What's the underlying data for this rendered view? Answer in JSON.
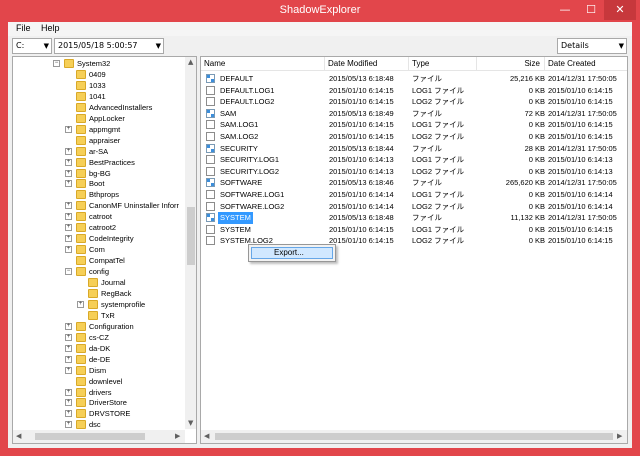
{
  "window": {
    "title": "ShadowExplorer",
    "min": "—",
    "max": "☐",
    "close": "✕"
  },
  "menu": {
    "file": "File",
    "help": "Help"
  },
  "toolbar": {
    "drive": "C:",
    "snapshot_date": "2015/05/18 5:00:57",
    "view": "Details",
    "arrow": "▼"
  },
  "tree": {
    "nodes": [
      {
        "label": "System32",
        "level": 0,
        "exp": "−"
      },
      {
        "label": "0409",
        "level": 1,
        "exp": ""
      },
      {
        "label": "1033",
        "level": 1,
        "exp": ""
      },
      {
        "label": "1041",
        "level": 1,
        "exp": ""
      },
      {
        "label": "AdvancedInstallers",
        "level": 1,
        "exp": ""
      },
      {
        "label": "AppLocker",
        "level": 1,
        "exp": ""
      },
      {
        "label": "appmgmt",
        "level": 1,
        "exp": "+"
      },
      {
        "label": "appraiser",
        "level": 1,
        "exp": ""
      },
      {
        "label": "ar-SA",
        "level": 1,
        "exp": "+"
      },
      {
        "label": "BestPractices",
        "level": 1,
        "exp": "+"
      },
      {
        "label": "bg-BG",
        "level": 1,
        "exp": "+"
      },
      {
        "label": "Boot",
        "level": 1,
        "exp": "+"
      },
      {
        "label": "Bthprops",
        "level": 1,
        "exp": ""
      },
      {
        "label": "CanonMF Uninstaller Inforr",
        "level": 1,
        "exp": "+"
      },
      {
        "label": "catroot",
        "level": 1,
        "exp": "+"
      },
      {
        "label": "catroot2",
        "level": 1,
        "exp": "+"
      },
      {
        "label": "CodeIntegrity",
        "level": 1,
        "exp": "+"
      },
      {
        "label": "Com",
        "level": 1,
        "exp": "+"
      },
      {
        "label": "CompatTel",
        "level": 1,
        "exp": ""
      },
      {
        "label": "config",
        "level": 1,
        "exp": "−"
      },
      {
        "label": "Journal",
        "level": 2,
        "exp": ""
      },
      {
        "label": "RegBack",
        "level": 2,
        "exp": ""
      },
      {
        "label": "systemprofile",
        "level": 2,
        "exp": "+"
      },
      {
        "label": "TxR",
        "level": 2,
        "exp": ""
      },
      {
        "label": "Configuration",
        "level": 1,
        "exp": "+"
      },
      {
        "label": "cs-CZ",
        "level": 1,
        "exp": "+"
      },
      {
        "label": "da-DK",
        "level": 1,
        "exp": "+"
      },
      {
        "label": "de-DE",
        "level": 1,
        "exp": "+"
      },
      {
        "label": "Dism",
        "level": 1,
        "exp": "+"
      },
      {
        "label": "downlevel",
        "level": 1,
        "exp": ""
      },
      {
        "label": "drivers",
        "level": 1,
        "exp": "+"
      },
      {
        "label": "DriverStore",
        "level": 1,
        "exp": "+"
      },
      {
        "label": "DRVSTORE",
        "level": 1,
        "exp": "+"
      },
      {
        "label": "dsc",
        "level": 1,
        "exp": "+"
      }
    ]
  },
  "list": {
    "columns": [
      "Name",
      "Date Modified",
      "Type",
      "Size",
      "Date Created"
    ],
    "rows": [
      {
        "name": "DEFAULT",
        "modified": "2015/05/13 6:18:48",
        "type": "ファイル",
        "size": "25,216 KB",
        "created": "2014/12/31 17:50:05",
        "icon": "reg"
      },
      {
        "name": "DEFAULT.LOG1",
        "modified": "2015/01/10 6:14:15",
        "type": "LOG1 ファイル",
        "size": "0 KB",
        "created": "2015/01/10 6:14:15",
        "icon": "log"
      },
      {
        "name": "DEFAULT.LOG2",
        "modified": "2015/01/10 6:14:15",
        "type": "LOG2 ファイル",
        "size": "0 KB",
        "created": "2015/01/10 6:14:15",
        "icon": "log"
      },
      {
        "name": "SAM",
        "modified": "2015/05/13 6:18:49",
        "type": "ファイル",
        "size": "72 KB",
        "created": "2014/12/31 17:50:05",
        "icon": "reg"
      },
      {
        "name": "SAM.LOG1",
        "modified": "2015/01/10 6:14:15",
        "type": "LOG1 ファイル",
        "size": "0 KB",
        "created": "2015/01/10 6:14:15",
        "icon": "log"
      },
      {
        "name": "SAM.LOG2",
        "modified": "2015/01/10 6:14:15",
        "type": "LOG2 ファイル",
        "size": "0 KB",
        "created": "2015/01/10 6:14:15",
        "icon": "log"
      },
      {
        "name": "SECURITY",
        "modified": "2015/05/13 6:18:44",
        "type": "ファイル",
        "size": "28 KB",
        "created": "2014/12/31 17:50:05",
        "icon": "reg"
      },
      {
        "name": "SECURITY.LOG1",
        "modified": "2015/01/10 6:14:13",
        "type": "LOG1 ファイル",
        "size": "0 KB",
        "created": "2015/01/10 6:14:13",
        "icon": "log"
      },
      {
        "name": "SECURITY.LOG2",
        "modified": "2015/01/10 6:14:13",
        "type": "LOG2 ファイル",
        "size": "0 KB",
        "created": "2015/01/10 6:14:13",
        "icon": "log"
      },
      {
        "name": "SOFTWARE",
        "modified": "2015/05/13 6:18:46",
        "type": "ファイル",
        "size": "265,620 KB",
        "created": "2014/12/31 17:50:05",
        "icon": "reg"
      },
      {
        "name": "SOFTWARE.LOG1",
        "modified": "2015/01/10 6:14:14",
        "type": "LOG1 ファイル",
        "size": "0 KB",
        "created": "2015/01/10 6:14:14",
        "icon": "log"
      },
      {
        "name": "SOFTWARE.LOG2",
        "modified": "2015/01/10 6:14:14",
        "type": "LOG2 ファイル",
        "size": "0 KB",
        "created": "2015/01/10 6:14:14",
        "icon": "log"
      },
      {
        "name": "SYSTEM",
        "modified": "2015/05/13 6:18:48",
        "type": "ファイル",
        "size": "11,132 KB",
        "created": "2014/12/31 17:50:05",
        "icon": "reg",
        "selected": true
      },
      {
        "name": "SYSTEM",
        "modified": "2015/01/10 6:14:15",
        "type": "LOG1 ファイル",
        "size": "0 KB",
        "created": "2015/01/10 6:14:15",
        "icon": "log"
      },
      {
        "name": "SYSTEM.LOG2",
        "modified": "2015/01/10 6:14:15",
        "type": "LOG2 ファイル",
        "size": "0 KB",
        "created": "2015/01/10 6:14:15",
        "icon": "log"
      }
    ]
  },
  "context_menu": {
    "export": "Export..."
  },
  "scroll": {
    "up": "▲",
    "down": "▼",
    "left": "◀",
    "right": "▶"
  }
}
